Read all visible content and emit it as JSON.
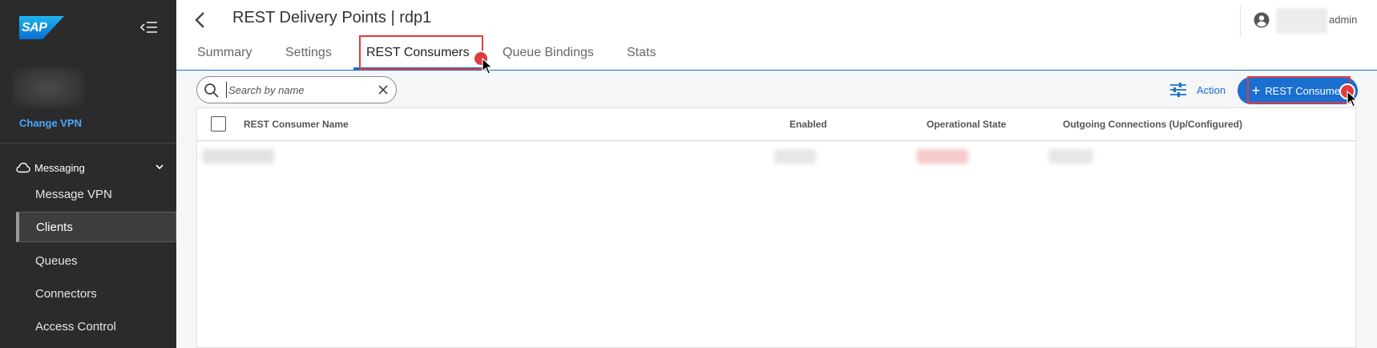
{
  "sidebar": {
    "logo_text": "SAP",
    "change_vpn_label": "Change VPN",
    "group_label": "Messaging",
    "items": [
      {
        "label": "Message VPN"
      },
      {
        "label": "Clients"
      },
      {
        "label": "Queues"
      },
      {
        "label": "Connectors"
      },
      {
        "label": "Access Control"
      }
    ],
    "active_item": "Clients"
  },
  "header": {
    "title": "REST Delivery Points | rdp1",
    "user_name": "admin"
  },
  "tabs": [
    {
      "label": "Summary"
    },
    {
      "label": "Settings"
    },
    {
      "label": "REST Consumers"
    },
    {
      "label": "Queue Bindings"
    },
    {
      "label": "Stats"
    }
  ],
  "active_tab": "REST Consumers",
  "toolbar": {
    "search_placeholder": "Search by name",
    "action_label": "Action",
    "add_button_label": "REST Consumer"
  },
  "table": {
    "columns": [
      {
        "label": "REST Consumer Name"
      },
      {
        "label": "Enabled"
      },
      {
        "label": "Operational State"
      },
      {
        "label": "Outgoing Connections (Up/Configured)"
      }
    ]
  },
  "colors": {
    "accent": "#1a6fd1",
    "sidebar_bg": "#2b2b2b",
    "highlight": "#e03c3c",
    "link": "#4aa8ff"
  },
  "icons": [
    "sap-logo",
    "collapse-menu-icon",
    "cloud-icon",
    "chevron-down-icon",
    "back-arrow-icon",
    "user-avatar-icon",
    "search-icon",
    "clear-icon",
    "sliders-icon",
    "plus-icon",
    "mouse-cursor-icon"
  ]
}
